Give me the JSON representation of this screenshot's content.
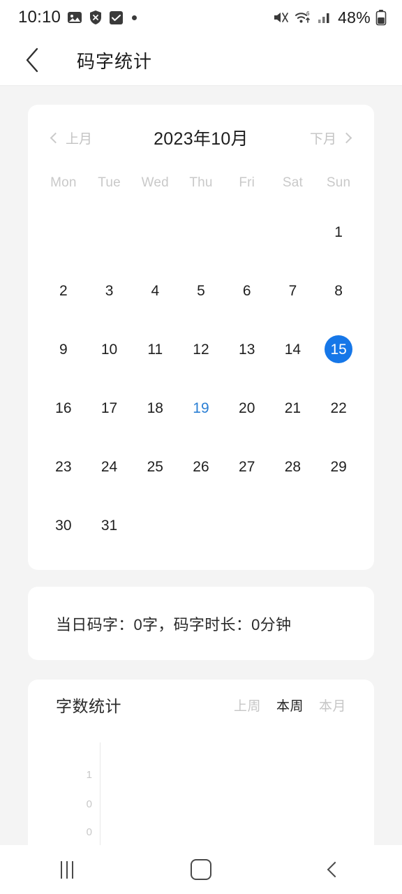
{
  "status_bar": {
    "time": "10:10",
    "battery_percent": "48%",
    "left_icons": [
      "image-icon",
      "shield-x-icon",
      "checkbox-icon",
      "dot-icon"
    ],
    "right_icons": [
      "mute-icon",
      "wifi-6-icon",
      "signal-icon",
      "battery-icon"
    ]
  },
  "header": {
    "back_label": "back-chevron",
    "title": "码字统计"
  },
  "calendar": {
    "prev_label": "上月",
    "month_label": "2023年10月",
    "next_label": "下月",
    "weekdays": [
      "Mon",
      "Tue",
      "Wed",
      "Thu",
      "Fri",
      "Sat",
      "Sun"
    ],
    "selected_day": 15,
    "today_day": 19,
    "accent_color": "#1677e8",
    "today_color": "#2b7fd4",
    "weeks": [
      [
        "",
        "",
        "",
        "",
        "",
        "",
        "1"
      ],
      [
        "2",
        "3",
        "4",
        "5",
        "6",
        "7",
        "8"
      ],
      [
        "9",
        "10",
        "11",
        "12",
        "13",
        "14",
        "15"
      ],
      [
        "16",
        "17",
        "18",
        "19",
        "20",
        "21",
        "22"
      ],
      [
        "23",
        "24",
        "25",
        "26",
        "27",
        "28",
        "29"
      ],
      [
        "30",
        "31",
        "",
        "",
        "",
        "",
        ""
      ]
    ]
  },
  "summary": {
    "text": "当日码字：0字，码字时长：0分钟"
  },
  "chart_card": {
    "title": "字数统计",
    "tabs": [
      {
        "label": "上周",
        "active": false
      },
      {
        "label": "本周",
        "active": true
      },
      {
        "label": "本月",
        "active": false
      }
    ]
  },
  "chart_data": {
    "type": "bar",
    "title": "字数统计",
    "categories": [],
    "values": [],
    "series": [
      {
        "name": "本周",
        "values": []
      }
    ],
    "ytick_labels": [
      "1",
      "0",
      "0"
    ],
    "ylim": [
      0,
      1
    ],
    "xlabel": "",
    "ylabel": "",
    "grid": false,
    "legend": "none",
    "note": "chart area is clipped by the bottom navigation bar; only the y-axis with ticks 1, 0, 0 is visible and no bars are drawn"
  },
  "nav_bar": {
    "items": [
      {
        "name": "recents",
        "icon": "recents-icon"
      },
      {
        "name": "home",
        "icon": "home-icon"
      },
      {
        "name": "back",
        "icon": "back-icon"
      }
    ]
  }
}
